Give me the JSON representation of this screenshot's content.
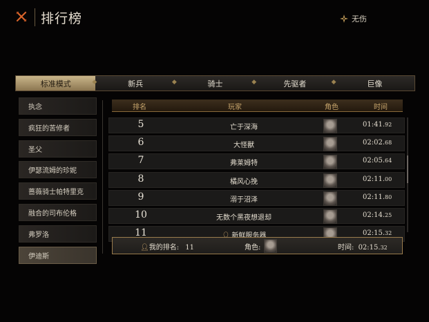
{
  "header": {
    "title": "排行榜",
    "status_label": "无伤"
  },
  "tabs": [
    {
      "label": "标准模式",
      "active": true
    },
    {
      "label": "新兵",
      "active": false
    },
    {
      "label": "骑士",
      "active": false
    },
    {
      "label": "先驱者",
      "active": false
    },
    {
      "label": "巨像",
      "active": false
    }
  ],
  "sidebar": {
    "items": [
      {
        "label": "执念",
        "active": false
      },
      {
        "label": "疯狂的苦修者",
        "active": false
      },
      {
        "label": "圣父",
        "active": false
      },
      {
        "label": "伊瑟流姆的珍妮",
        "active": false
      },
      {
        "label": "蔷薇骑士帕特里克",
        "active": false
      },
      {
        "label": "融合的司布伦格",
        "active": false
      },
      {
        "label": "弗罗洛",
        "active": false
      },
      {
        "label": "伊迪斯",
        "active": true
      }
    ]
  },
  "table": {
    "headers": {
      "rank": "排名",
      "player": "玩家",
      "character": "角色",
      "time": "时间"
    },
    "rows": [
      {
        "rank": "5",
        "player": "亡于深海",
        "time_main": "01:41.",
        "time_ms": "92",
        "highlight": false
      },
      {
        "rank": "6",
        "player": "大怪獸",
        "time_main": "02:02.",
        "time_ms": "68",
        "highlight": false
      },
      {
        "rank": "7",
        "player": "弗莱姆特",
        "time_main": "02:05.",
        "time_ms": "64",
        "highlight": false
      },
      {
        "rank": "8",
        "player": "橘风心挽",
        "time_main": "02:11.",
        "time_ms": "00",
        "highlight": false
      },
      {
        "rank": "9",
        "player": "溺于沼泽",
        "time_main": "02:11.",
        "time_ms": "80",
        "highlight": false
      },
      {
        "rank": "10",
        "player": "无数个黑夜想退却",
        "time_main": "02:14.",
        "time_ms": "25",
        "highlight": false
      },
      {
        "rank": "11",
        "player": "新鲜服务器",
        "time_main": "02:15.",
        "time_ms": "32",
        "highlight": true
      }
    ]
  },
  "my_rank": {
    "rank_label": "我的排名:",
    "rank_value": "11",
    "character_label": "角色:",
    "time_label": "时间:",
    "time_main": "02:15.",
    "time_ms": "32"
  },
  "colors": {
    "accent_gold": "#c7a56c",
    "close_icon": "#d9642a",
    "active_tab": "#b8a37a"
  },
  "icons": {
    "close": "close-icon",
    "status": "compass-star-icon",
    "player_marker": "user-icon"
  }
}
